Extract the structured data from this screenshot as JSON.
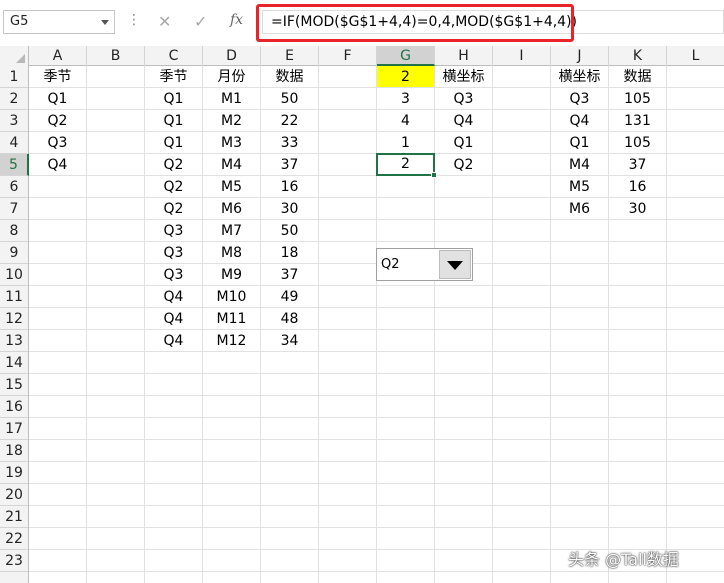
{
  "formula_bar": {
    "name_box": "G5",
    "formula": "=IF(MOD($G$1+4,4)=0,4,MOD($G$1+4,4))",
    "cancel_glyph": "✕",
    "enter_glyph": "✓",
    "fx_glyph": "fx",
    "more_glyph": "⋮"
  },
  "columns": [
    "A",
    "B",
    "C",
    "D",
    "E",
    "F",
    "G",
    "H",
    "I",
    "J",
    "K",
    "L"
  ],
  "selected_column": "G",
  "selected_row": 5,
  "row_numbers": [
    "1",
    "2",
    "3",
    "4",
    "5",
    "6",
    "7",
    "8",
    "9",
    "10",
    "11",
    "12",
    "13",
    "14",
    "15",
    "16",
    "17",
    "18",
    "19",
    "20",
    "21",
    "22",
    "23"
  ],
  "cells": {
    "A": [
      "季节",
      "Q1",
      "Q2",
      "Q3",
      "Q4"
    ],
    "C": [
      "季节",
      "Q1",
      "Q1",
      "Q1",
      "Q2",
      "Q2",
      "Q2",
      "Q3",
      "Q3",
      "Q3",
      "Q4",
      "Q4",
      "Q4"
    ],
    "D": [
      "月份",
      "M1",
      "M2",
      "M3",
      "M4",
      "M5",
      "M6",
      "M7",
      "M8",
      "M9",
      "M10",
      "M11",
      "M12"
    ],
    "E": [
      "数据",
      "50",
      "22",
      "33",
      "37",
      "16",
      "30",
      "50",
      "18",
      "37",
      "49",
      "48",
      "34"
    ],
    "G": [
      "2",
      "3",
      "4",
      "1",
      "2"
    ],
    "H": [
      "横坐标",
      "Q3",
      "Q4",
      "Q1",
      "Q2"
    ],
    "J": [
      "横坐标",
      "Q3",
      "Q4",
      "Q1",
      "M4",
      "M5",
      "M6"
    ],
    "K": [
      "数据",
      "105",
      "131",
      "105",
      "37",
      "16",
      "30"
    ]
  },
  "highlight_color": "#ffff00",
  "accent_color": "#217346",
  "annotation_color": "#e8232a",
  "combobox": {
    "value": "Q2",
    "icon": "dropdown-arrow-icon"
  },
  "watermark": "头条 @Tall数据"
}
